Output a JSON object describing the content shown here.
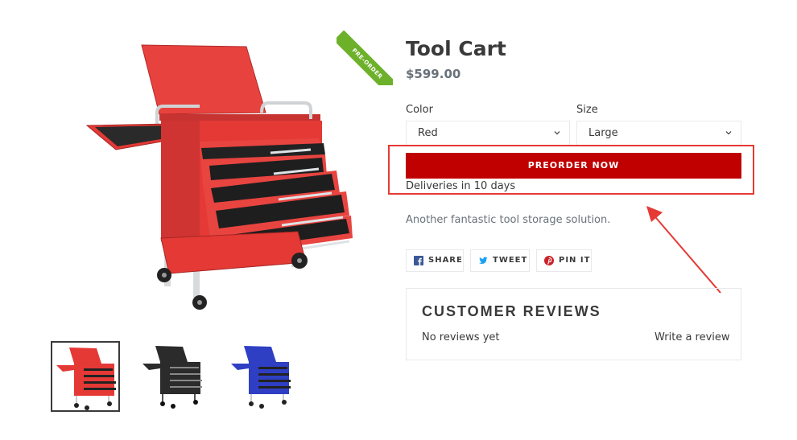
{
  "product": {
    "title": "Tool Cart",
    "price": "$599.00",
    "badge": "PRE-ORDER",
    "description": "Another fantastic tool storage solution."
  },
  "options": {
    "color": {
      "label": "Color",
      "value": "Red"
    },
    "size": {
      "label": "Size",
      "value": "Large"
    }
  },
  "purchase": {
    "button_label": "PREORDER NOW",
    "delivery_note": "Deliveries in 10 days"
  },
  "share": {
    "facebook": "SHARE",
    "twitter": "TWEET",
    "pinterest": "PIN IT"
  },
  "reviews": {
    "title": "CUSTOMER REVIEWS",
    "empty_text": "No reviews yet",
    "write_link": "Write a review"
  },
  "thumbnails": [
    {
      "variant": "red",
      "color": "#e53935",
      "selected": true
    },
    {
      "variant": "black",
      "color": "#2b2b2b",
      "selected": false
    },
    {
      "variant": "blue",
      "color": "#2f3fc4",
      "selected": false
    }
  ],
  "colors": {
    "accent_button": "#c00000",
    "annotation": "#e53935",
    "ribbon": "#6db12b",
    "cart_red": "#e53935"
  }
}
